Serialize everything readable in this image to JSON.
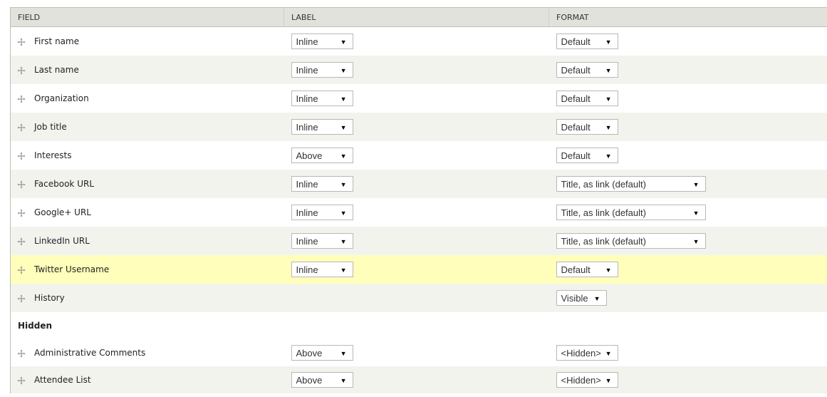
{
  "headers": {
    "field": "FIELD",
    "label": "LABEL",
    "format": "FORMAT"
  },
  "rows": [
    {
      "field": "First name",
      "label": "Inline",
      "format": "Default"
    },
    {
      "field": "Last name",
      "label": "Inline",
      "format": "Default"
    },
    {
      "field": "Organization",
      "label": "Inline",
      "format": "Default"
    },
    {
      "field": "Job title",
      "label": "Inline",
      "format": "Default"
    },
    {
      "field": "Interests",
      "label": "Above",
      "format": "Default"
    },
    {
      "field": "Facebook URL",
      "label": "Inline",
      "format": "Title, as link (default)"
    },
    {
      "field": "Google+ URL",
      "label": "Inline",
      "format": "Title, as link (default)"
    },
    {
      "field": "LinkedIn URL",
      "label": "Inline",
      "format": "Title, as link (default)"
    },
    {
      "field": "Twitter Username",
      "label": "Inline",
      "format": "Default"
    },
    {
      "field": "History",
      "format": "Visible"
    }
  ],
  "hidden_region": "Hidden",
  "hidden_rows": [
    {
      "field": "Administrative Comments",
      "label": "Above",
      "format": "<Hidden>"
    },
    {
      "field": "Attendee List",
      "label": "Above",
      "format": "<Hidden>"
    }
  ],
  "arrow": "▼",
  "colors": {
    "highlight": "#ffffbb",
    "stripe": "#f3f3ee",
    "header": "#e1e2dc"
  }
}
